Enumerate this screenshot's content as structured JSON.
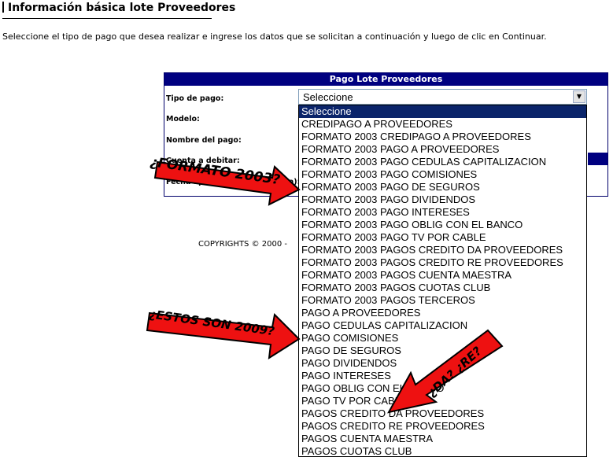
{
  "header": {
    "title": "Información básica lote Proveedores",
    "instructions": "Seleccione el tipo de pago que desea realizar e ingrese los datos que se solicitan a continuación y luego de clic en Continuar."
  },
  "panel": {
    "title": "Pago Lote Proveedores",
    "labels": {
      "tipo_pago": "Tipo de pago:",
      "modelo": "Modelo:",
      "nombre_pago": "Nombre del pago:",
      "cuenta_debitar": "Cuenta a debitar:",
      "fecha_aplicacion": "Fecha aplicación (dd/mm/aaaa):"
    },
    "select_value": "Seleccione"
  },
  "dropdown": {
    "options": [
      "Seleccione",
      "CREDIPAGO A PROVEEDORES",
      "FORMATO 2003 CREDIPAGO A PROVEEDORES",
      "FORMATO 2003 PAGO A PROVEEDORES",
      "FORMATO 2003 PAGO CEDULAS CAPITALIZACION",
      "FORMATO 2003 PAGO COMISIONES",
      "FORMATO 2003 PAGO DE SEGUROS",
      "FORMATO 2003 PAGO DIVIDENDOS",
      "FORMATO 2003 PAGO INTERESES",
      "FORMATO 2003 PAGO OBLIG CON EL BANCO",
      "FORMATO 2003 PAGO TV POR CABLE",
      "FORMATO 2003 PAGOS CREDITO DA PROVEEDORES",
      "FORMATO 2003 PAGOS CREDITO RE PROVEEDORES",
      "FORMATO 2003 PAGOS CUENTA MAESTRA",
      "FORMATO 2003 PAGOS CUOTAS CLUB",
      "FORMATO 2003 PAGOS TERCEROS",
      "PAGO A PROVEEDORES",
      "PAGO CEDULAS CAPITALIZACION",
      "PAGO COMISIONES",
      "PAGO DE SEGUROS",
      "PAGO DIVIDENDOS",
      "PAGO INTERESES",
      "PAGO OBLIG CON EL BANCO",
      "PAGO TV POR CABLE",
      "PAGOS CREDITO DA PROVEEDORES",
      "PAGOS CREDITO RE PROVEEDORES",
      "PAGOS CUENTA MAESTRA",
      "PAGOS CUOTAS CLUB"
    ],
    "selected_index": 0
  },
  "footer": {
    "copyright": "COPYRIGHTS © 2000 -"
  },
  "annotations": {
    "formato": "¿FORMATO 2003?",
    "estos": "¿ESTOS SON 2009?",
    "da_re": "¿DA? ¿RE?",
    "arrow_color": "#ee1111"
  }
}
